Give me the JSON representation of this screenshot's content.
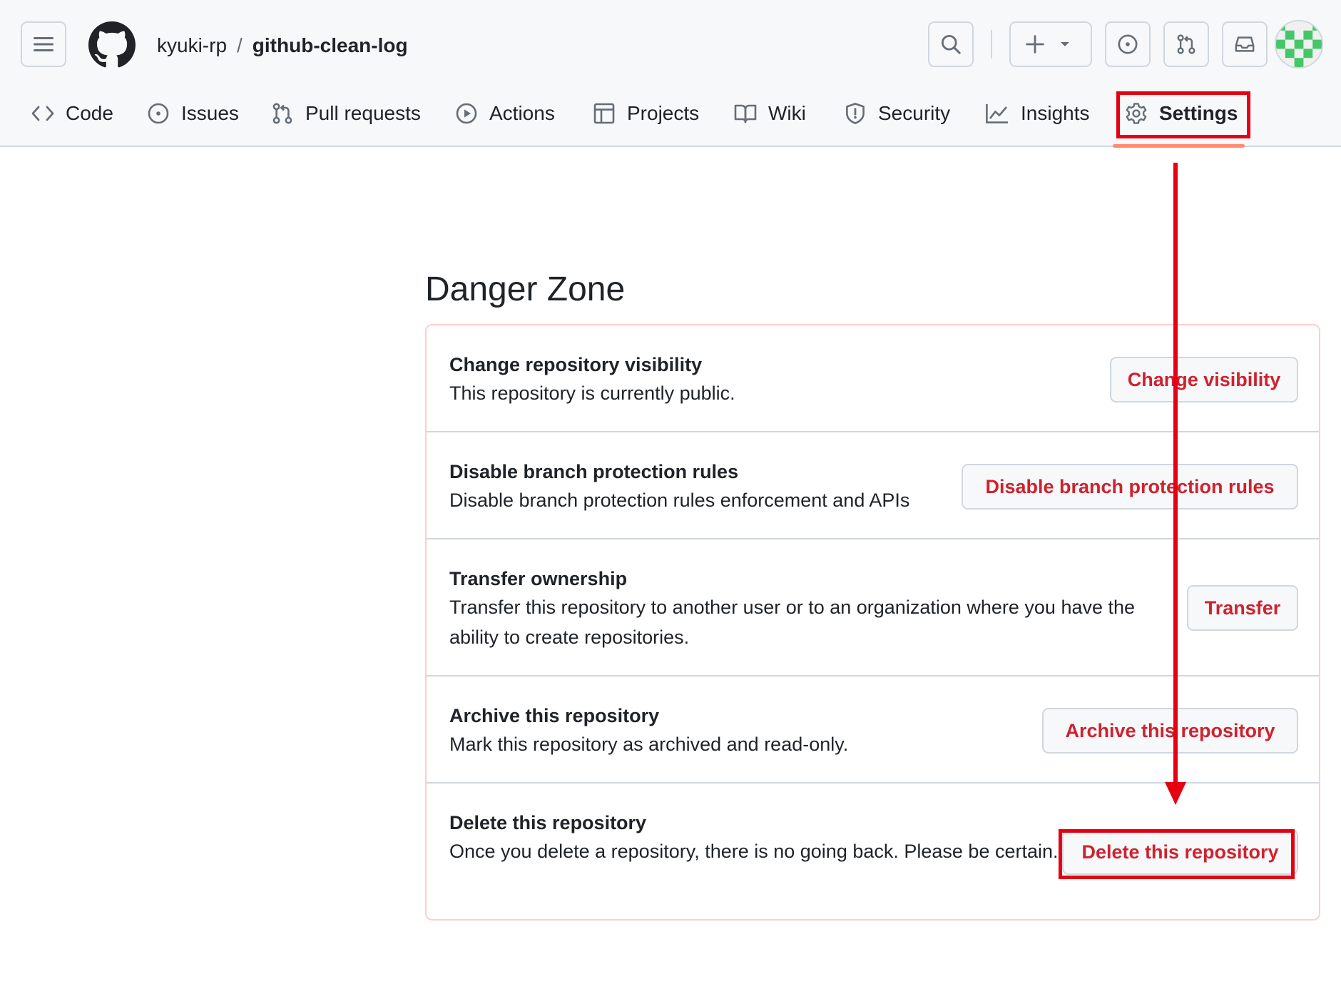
{
  "header": {
    "owner": "kyuki-rp",
    "separator": "/",
    "repo_name": "github-clean-log",
    "icons": {
      "menu": "hamburger-icon",
      "logo": "github-mark-icon",
      "search": "search-icon",
      "create": "plus-icon",
      "create_dropdown": "triangle-down-icon",
      "issues": "issue-opened-icon",
      "pull_requests": "git-pull-request-icon",
      "inbox": "inbox-icon",
      "avatar": "identicon-avatar"
    }
  },
  "tabs": [
    {
      "label": "Code",
      "icon": "code-icon",
      "selected": false
    },
    {
      "label": "Issues",
      "icon": "issue-opened-icon",
      "selected": false
    },
    {
      "label": "Pull requests",
      "icon": "git-pull-request-icon",
      "selected": false
    },
    {
      "label": "Actions",
      "icon": "play-icon",
      "selected": false
    },
    {
      "label": "Projects",
      "icon": "table-icon",
      "selected": false
    },
    {
      "label": "Wiki",
      "icon": "book-icon",
      "selected": false
    },
    {
      "label": "Security",
      "icon": "shield-icon",
      "selected": false
    },
    {
      "label": "Insights",
      "icon": "graph-icon",
      "selected": false
    },
    {
      "label": "Settings",
      "icon": "gear-icon",
      "selected": true
    }
  ],
  "danger_zone": {
    "title": "Danger Zone",
    "rows": [
      {
        "title": "Change repository visibility",
        "description": "This repository is currently public.",
        "button": "Change visibility"
      },
      {
        "title": "Disable branch protection rules",
        "description": "Disable branch protection rules enforcement and APIs",
        "button": "Disable branch protection rules"
      },
      {
        "title": "Transfer ownership",
        "description": "Transfer this repository to another user or to an organization where you have the ability to create repositories.",
        "button": "Transfer"
      },
      {
        "title": "Archive this repository",
        "description": "Mark this repository as archived and read-only.",
        "button": "Archive this repository"
      },
      {
        "title": "Delete this repository",
        "description": "Once you delete a repository, there is no going back. Please be certain.",
        "button": "Delete this repository"
      }
    ]
  },
  "colors": {
    "danger_text": "#cf222e",
    "danger_border": "#ffcecb",
    "selected_tab_underline": "#fd8c73",
    "annotation_red": "#e60012",
    "header_bg": "#f6f8fa",
    "avatar_green": "#44c767"
  }
}
